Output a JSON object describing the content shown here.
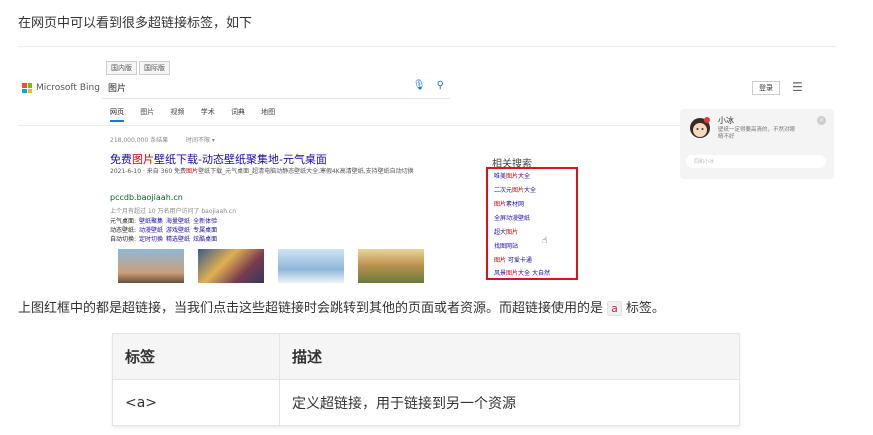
{
  "intro_text": "在网页中可以看到很多超链接标签，如下",
  "screenshot": {
    "region_tabs": [
      "国内版",
      "国际版"
    ],
    "brand": "Microsoft Bing",
    "query": "图片",
    "login": "登录",
    "nav": [
      "网页",
      "图片",
      "视频",
      "学术",
      "词典",
      "地图"
    ],
    "result_count": "218,000,000 条结果",
    "time_filter": "时间不限 ▾",
    "result_title": {
      "pre": "免费",
      "hl": "图片",
      "post": "壁纸下载-动态壁纸聚集地-元气桌面"
    },
    "snippet": {
      "pre": "2021-6-10 · 来自 360 免费",
      "hl": "图片",
      "post": "壁纸下载_元气桌面_超清电脑动静态壁纸大全,寒假4K高清壁纸,支持壁纸自动切换"
    },
    "url": "pccdb.baojiaah.cn",
    "visited": "上个月有超过 10 万名用户访问了 baojiaah.cn",
    "sitelinks": [
      {
        "label": "元气桌面:",
        "links": [
          "壁纸聚集",
          "海量壁纸",
          "全新体验"
        ]
      },
      {
        "label": "动态壁纸:",
        "links": [
          "动漫壁纸",
          "游戏壁纸",
          "专属桌面"
        ]
      },
      {
        "label": "自动切换:",
        "links": [
          "定时切换",
          "精选壁纸",
          "炫酷桌面"
        ]
      }
    ],
    "related_title": "相关搜索",
    "related": [
      {
        "pre": "唯美",
        "hl": "图片",
        "post": "大全"
      },
      {
        "pre": "二次元",
        "hl": "图片",
        "post": "大全"
      },
      {
        "pre": "",
        "hl": "图片",
        "post": "素材网"
      },
      {
        "pre": "全屏动漫壁纸",
        "hl": "",
        "post": ""
      },
      {
        "pre": "超大",
        "hl": "图片",
        "post": ""
      },
      {
        "pre": "找图网站",
        "hl": "",
        "post": ""
      },
      {
        "pre": "",
        "hl": "图片",
        "post": " 可爱卡通"
      },
      {
        "pre": "风景",
        "hl": "图片",
        "post": "大全 大自然"
      }
    ],
    "chat": {
      "name": "小冰",
      "message": "壁纸一定得要高清的，不然对眼睛不好",
      "input_placeholder": "同和小冰"
    }
  },
  "description": {
    "pre": "上图红框中的都是超链接，当我们点击这些超链接时会跳转到其他的页面或者资源。而超链接使用的是",
    "code": "a",
    "post": "标签。"
  },
  "table": {
    "headers": [
      "标签",
      "描述"
    ],
    "rows": [
      [
        "<a>",
        "定义超链接，用于链接到另一个资源"
      ]
    ]
  },
  "colors": {
    "highlight": "#e60000",
    "link": "#1a0dab",
    "box": "#d9141b"
  }
}
